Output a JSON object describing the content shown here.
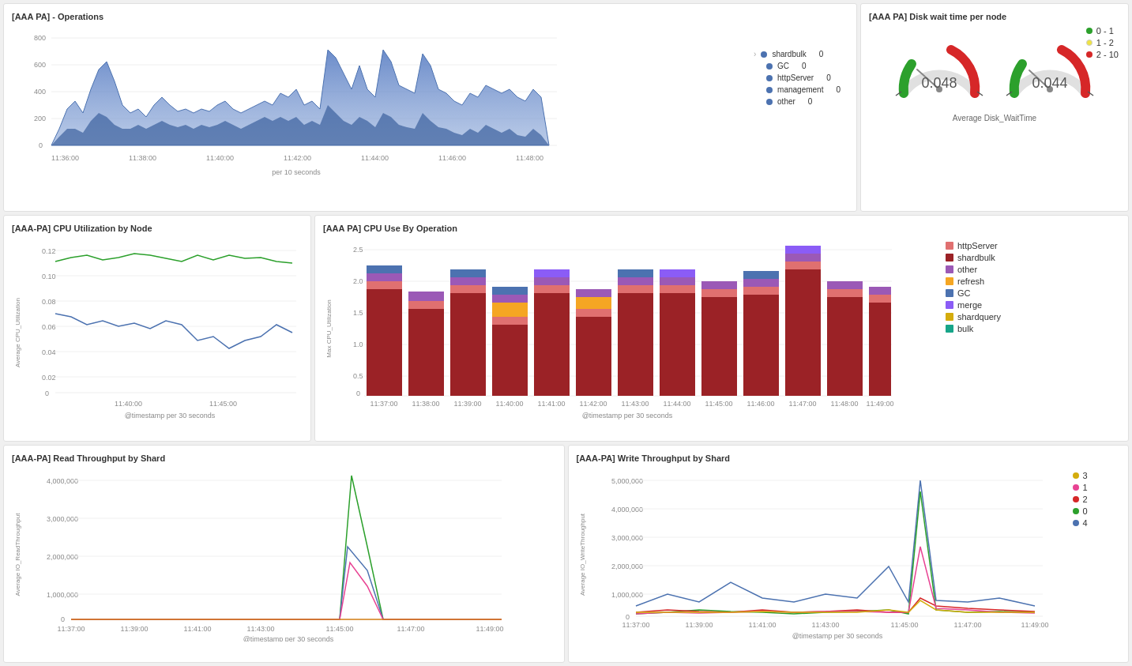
{
  "panels": {
    "ops": {
      "title": "[AAA PA] - Operations",
      "xLabel": "per 10 seconds",
      "yValues": [
        "800",
        "600",
        "400",
        "200",
        "0"
      ],
      "xTimes": [
        "11:36:00",
        "11:38:00",
        "11:40:00",
        "11:42:00",
        "11:44:00",
        "11:46:00",
        "11:48:00"
      ],
      "legend": [
        {
          "label": "shardbulk",
          "value": "0",
          "color": "#4c72b0"
        },
        {
          "label": "GC",
          "value": "0",
          "color": "#4c72b0"
        },
        {
          "label": "httpServer",
          "value": "0",
          "color": "#4c72b0"
        },
        {
          "label": "management",
          "value": "0",
          "color": "#4c72b0"
        },
        {
          "label": "other",
          "value": "0",
          "color": "#4c72b0"
        }
      ]
    },
    "disk": {
      "title": "[AAA PA] Disk wait time per node",
      "legend": [
        {
          "label": "0 - 1",
          "color": "#2ca02c"
        },
        {
          "label": "1 - 2",
          "color": "#f0e442"
        },
        {
          "label": "2 - 10",
          "color": "#d62728"
        }
      ],
      "gauges": [
        {
          "value": "0.048",
          "color": "#888"
        },
        {
          "value": "0.044",
          "color": "#888"
        }
      ],
      "subtitle": "Average Disk_WaitTime"
    },
    "cpuNode": {
      "title": "[AAA-PA] CPU Utilization by Node",
      "yLabel": "Average CPU_Utilization",
      "xLabel": "@timestamp per 30 seconds",
      "yValues": [
        "0.12",
        "0.10",
        "0.08",
        "0.06",
        "0.04",
        "0.02",
        "0"
      ],
      "xTimes": [
        "11:40:00",
        "11:45:00"
      ]
    },
    "cpuOp": {
      "title": "[AAA PA] CPU Use By Operation",
      "yLabel": "Max CPU_Utilization",
      "xLabel": "@timestamp per 30 seconds",
      "yValues": [
        "2.5",
        "2.0",
        "1.5",
        "1.0",
        "0.5",
        "0"
      ],
      "xTimes": [
        "11:37:00",
        "11:38:00",
        "11:39:00",
        "11:40:00",
        "11:41:00",
        "11:42:00",
        "11:43:00",
        "11:44:00",
        "11:45:00",
        "11:46:00",
        "11:47:00",
        "11:48:00",
        "11:49:00"
      ],
      "legend": [
        {
          "label": "httpServer",
          "color": "#e07070"
        },
        {
          "label": "shardbulk",
          "color": "#9b2226"
        },
        {
          "label": "other",
          "color": "#9b59b6"
        },
        {
          "label": "refresh",
          "color": "#f5a623"
        },
        {
          "label": "GC",
          "color": "#4c72b0"
        },
        {
          "label": "merge",
          "color": "#8b5cf6"
        },
        {
          "label": "shardquery",
          "color": "#d4ac0d"
        },
        {
          "label": "bulk",
          "color": "#17a589"
        }
      ]
    },
    "readThroughput": {
      "title": "[AAA-PA] Read Throughput by Shard",
      "yLabel": "Average IO_ReadThroughput",
      "xLabel": "@timestamp per 30 seconds",
      "yValues": [
        "4,000,000",
        "3,000,000",
        "2,000,000",
        "1,000,000",
        "0"
      ],
      "xTimes": [
        "11:37:00",
        "11:39:00",
        "11:41:00",
        "11:43:00",
        "11:45:00",
        "11:47:00",
        "11:49:00"
      ]
    },
    "writeThroughput": {
      "title": "[AAA-PA] Write Throughput by Shard",
      "yLabel": "Average IO_WriteThroughput",
      "xLabel": "@timestamp per 30 seconds",
      "yValues": [
        "5,000,000",
        "4,000,000",
        "3,000,000",
        "2,000,000",
        "1,000,000",
        "0"
      ],
      "xTimes": [
        "11:37:00",
        "11:39:00",
        "11:41:00",
        "11:43:00",
        "11:45:00",
        "11:47:00",
        "11:49:00"
      ],
      "legend": [
        {
          "label": "3",
          "color": "#d4ac0d"
        },
        {
          "label": "1",
          "color": "#e84393"
        },
        {
          "label": "2",
          "color": "#d62728"
        },
        {
          "label": "0",
          "color": "#2ca02c"
        },
        {
          "label": "4",
          "color": "#4c72b0"
        }
      ]
    }
  }
}
